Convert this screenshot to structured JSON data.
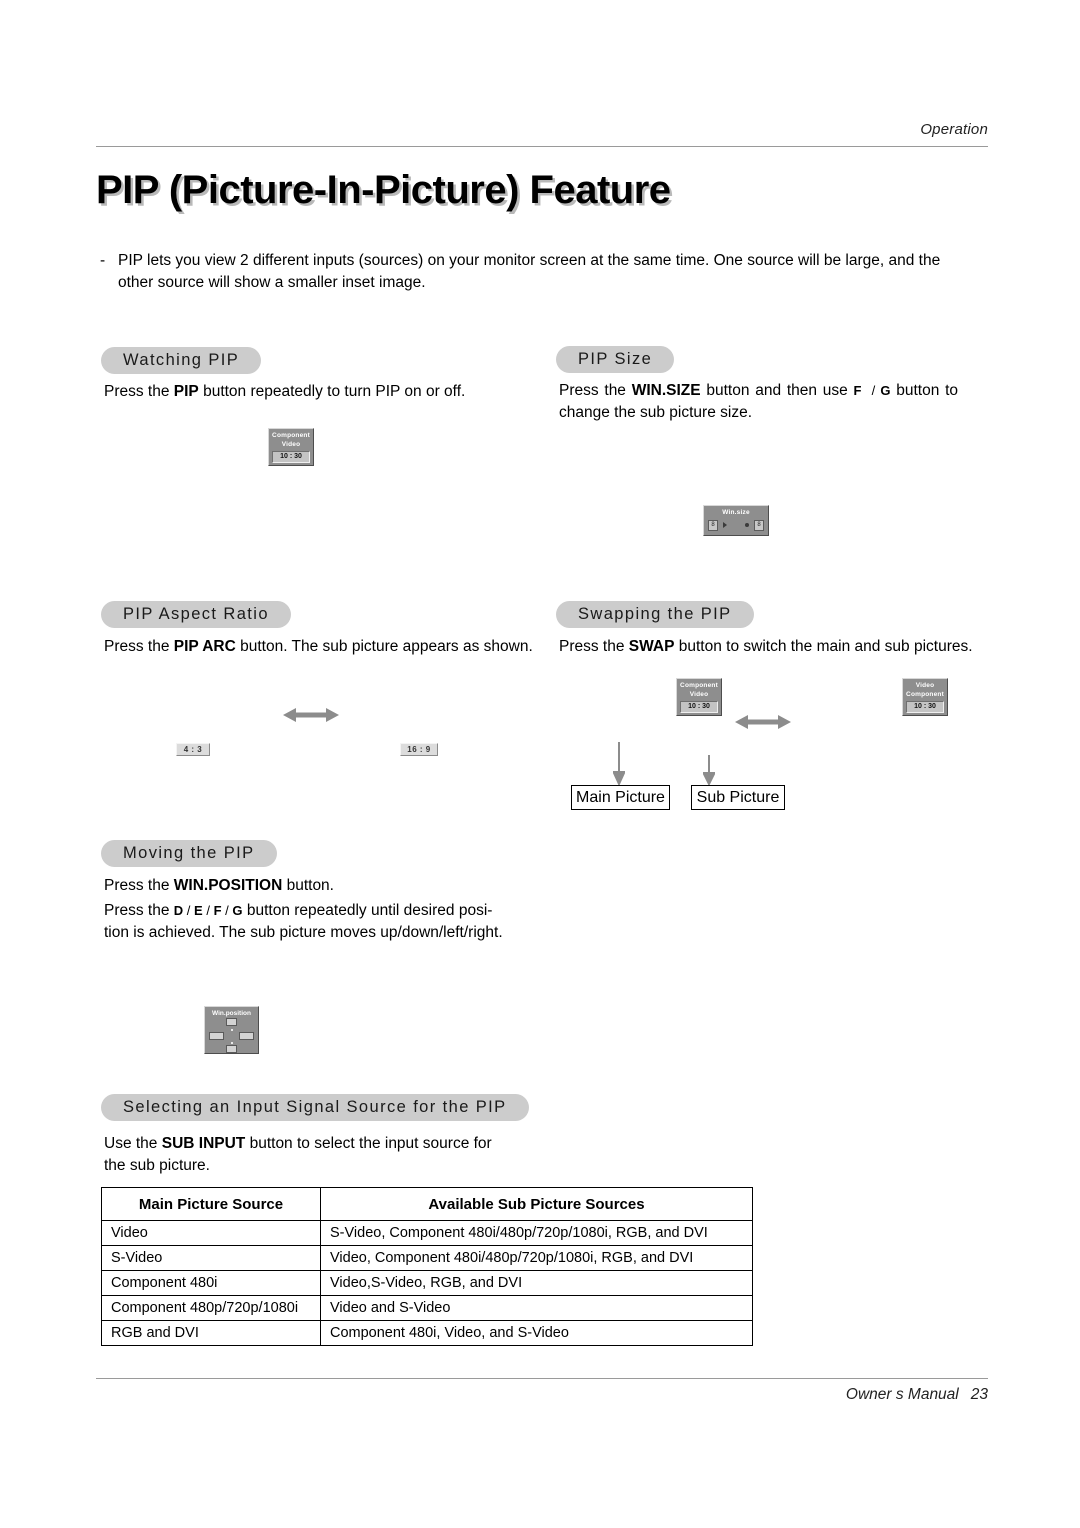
{
  "header": {
    "running_head": "Operation"
  },
  "page_title": "PIP (Picture-In-Picture) Feature",
  "intro": {
    "bullet": "-",
    "text": "PIP lets you view 2 different inputs (sources) on your monitor screen at the same time. One source will be large, and the other source will show a smaller inset image."
  },
  "sections": {
    "watching_pip": {
      "heading": "Watching PIP",
      "body_before": "Press the ",
      "body_bold": "PIP",
      "body_after": " button repeatedly to turn PIP on or off.",
      "osd": {
        "line1": "Component",
        "line2": "Video",
        "clock": "10 : 30",
        "clock_prefix": "·"
      }
    },
    "pip_size": {
      "heading": "PIP Size",
      "body_p1": "Press the ",
      "body_bold": "WIN.SIZE",
      "body_p2": " button and then use ",
      "key_left": "F",
      "key_sep": "/",
      "key_right": "G",
      "body_p3": " button to change the sub picture size.",
      "osd": {
        "title": "Win.size",
        "chip_left": "8",
        "chip_right": "8"
      }
    },
    "pip_aspect_ratio": {
      "heading": "PIP Aspect Ratio",
      "body_p1": "Press the ",
      "body_bold": "PIP ARC",
      "body_p2": " button. The sub picture appears as shown.",
      "chip_left": "4 : 3",
      "chip_right": "16 : 9"
    },
    "swapping_the_pip": {
      "heading": "Swapping the PIP",
      "body_p1": "Press the ",
      "body_bold": "SWAP",
      "body_p2": " button to switch the main and sub pictures.",
      "osd_left": {
        "line1": "Component",
        "line2": "Video",
        "clock": "10 : 30"
      },
      "osd_right": {
        "line1": "Video",
        "line2": "Component",
        "clock": "10 : 30"
      },
      "label_main": "Main Picture",
      "label_sub": "Sub Picture"
    },
    "moving_the_pip": {
      "heading": "Moving the PIP",
      "line1_p1": "Press the ",
      "line1_bold": "WIN.POSITION",
      "line1_p2": " button.",
      "line2_p1": "Press the ",
      "key_d": "D",
      "key_e": "E",
      "key_f": "F",
      "key_g": "G",
      "key_sep": "/",
      "line2_p2": " button repeatedly until desired posi-",
      "line3": "tion is achieved. The sub picture moves up/down/left/right.",
      "osd": {
        "title": "Win.position"
      }
    },
    "selecting_input": {
      "heading": "Selecting an Input Signal Source for the PIP",
      "body_p1": "Use the ",
      "body_bold": "SUB INPUT",
      "body_p2": " button to select the input source for",
      "body_line2": "the sub picture."
    }
  },
  "table": {
    "headers": [
      "Main Picture Source",
      "Available Sub Picture Sources"
    ],
    "rows": [
      [
        "Video",
        "S-Video, Component 480i/480p/720p/1080i, RGB, and DVI"
      ],
      [
        "S-Video",
        "Video, Component 480i/480p/720p/1080i, RGB, and DVI"
      ],
      [
        "Component 480i",
        "Video,S-Video, RGB, and DVI"
      ],
      [
        "Component 480p/720p/1080i",
        "Video and S-Video"
      ],
      [
        "RGB and DVI",
        "Component 480i, Video, and S-Video"
      ]
    ]
  },
  "footer": {
    "text": "Owner s Manual",
    "page_number": "23"
  },
  "colors": {
    "pill_bg": "#cccccc",
    "rule": "#9a9a9a",
    "osd_bg": "#8e8e8e",
    "arrow": "#8c8c8c"
  }
}
